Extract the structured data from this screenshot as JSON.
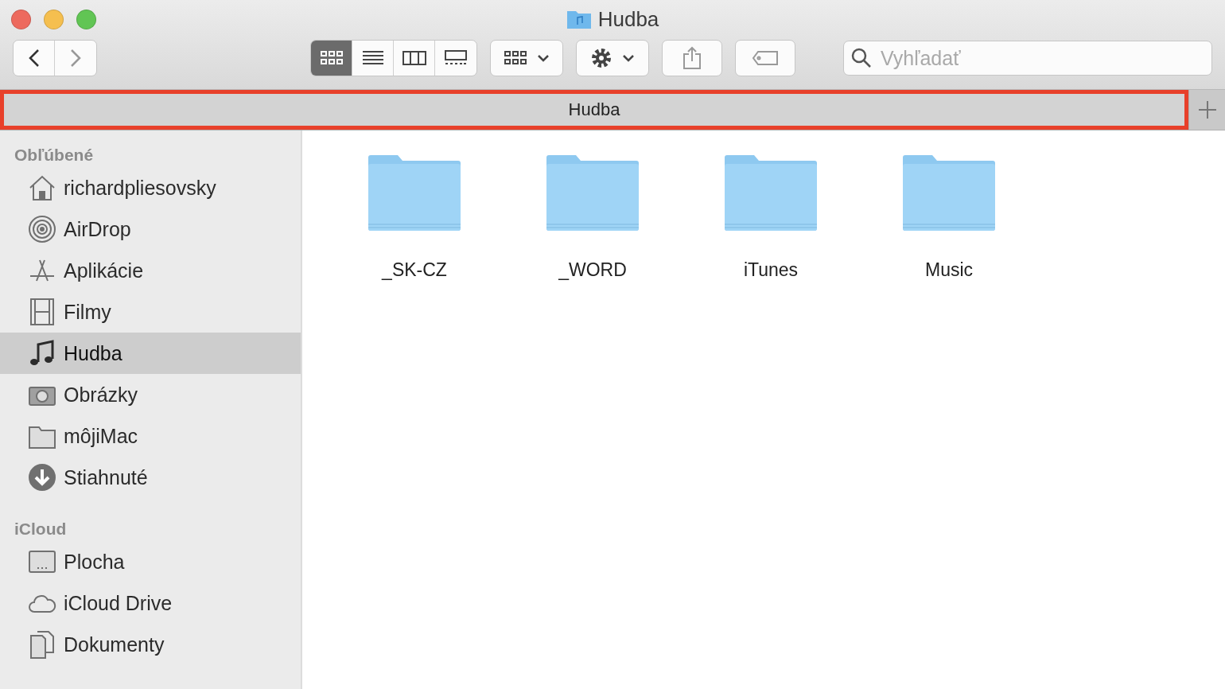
{
  "window": {
    "title": "Hudba"
  },
  "toolbar": {
    "view_modes": [
      {
        "kind": "icons",
        "selected": true
      },
      {
        "kind": "list",
        "selected": false
      },
      {
        "kind": "columns",
        "selected": false
      },
      {
        "kind": "gallery",
        "selected": false
      }
    ],
    "search": {
      "placeholder": "Vyhľadať"
    }
  },
  "tab_bar": {
    "highlighted": true,
    "tabs": [
      {
        "label": "Hudba",
        "selected": true
      }
    ]
  },
  "sidebar": {
    "sections": [
      {
        "title": "Obľúbené",
        "items": [
          {
            "label": "richardpliesovsky",
            "kind": "home",
            "selected": false
          },
          {
            "label": "AirDrop",
            "kind": "airdrop",
            "selected": false
          },
          {
            "label": "Aplikácie",
            "kind": "apps",
            "selected": false
          },
          {
            "label": "Filmy",
            "kind": "film",
            "selected": false
          },
          {
            "label": "Hudba",
            "kind": "music",
            "selected": true
          },
          {
            "label": "Obrázky",
            "kind": "camera",
            "selected": false
          },
          {
            "label": "môjiMac",
            "kind": "folder",
            "selected": false
          },
          {
            "label": "Stiahnuté",
            "kind": "download",
            "selected": false
          }
        ]
      },
      {
        "title": "iCloud",
        "items": [
          {
            "label": "Plocha",
            "kind": "desktop",
            "selected": false
          },
          {
            "label": "iCloud Drive",
            "kind": "cloud",
            "selected": false
          },
          {
            "label": "Dokumenty",
            "kind": "document",
            "selected": false
          }
        ]
      }
    ]
  },
  "files": [
    {
      "name": "_SK-CZ"
    },
    {
      "name": "_WORD"
    },
    {
      "name": "iTunes"
    },
    {
      "name": "Music"
    }
  ]
}
